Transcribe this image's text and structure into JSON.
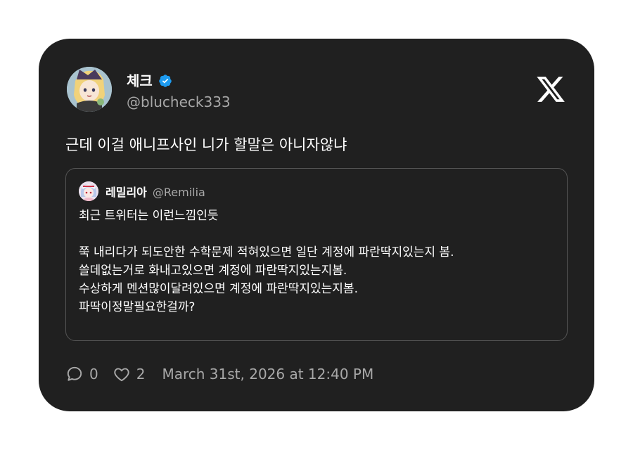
{
  "tweet": {
    "display_name": "체크",
    "handle": "@blucheck333",
    "text": "근데 이걸 애니프사인 니가 할말은 아니자않냐",
    "verified_icon": "verified-badge-icon",
    "logo_icon": "x-logo-icon"
  },
  "quote": {
    "display_name": "레밀리아",
    "handle": "@Remilia",
    "text": "최근 트위터는 이런느낌인듯\n\n쭉 내리다가 되도안한 수학문제 적혀있으면 일단 계정에 파란딱지있는지 봄.\n쓸데없는거로 화내고있으면 계정에 파란딱지있는지봄.\n수상하게 멘션많이달려있으면 계정에 파란딱지있는지봄.\n파딱이정말필요한걸까?"
  },
  "footer": {
    "reply_count": "0",
    "like_count": "2",
    "timestamp": "March 31st, 2026 at 12:40 PM",
    "reply_icon": "comment-icon",
    "like_icon": "heart-icon"
  },
  "colors": {
    "card_bg": "#202020",
    "text": "#ffffff",
    "muted": "#a8a8a8",
    "verified": "#1d9bf0"
  }
}
